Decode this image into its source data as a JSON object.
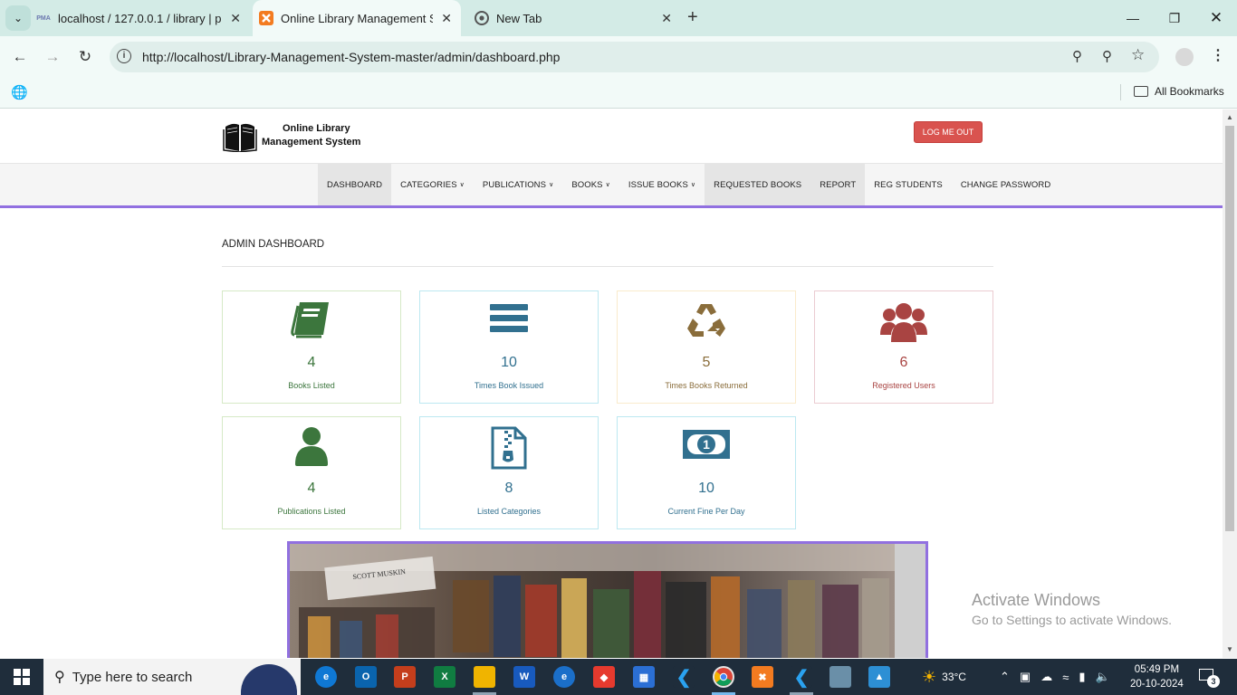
{
  "browser": {
    "tabs": [
      {
        "title": "localhost / 127.0.0.1 / library | p",
        "icon": "phpmyadmin-icon",
        "favicon_text": "PMA"
      },
      {
        "title": "Online Library Management Sys",
        "icon": "xampp-icon",
        "active": true
      },
      {
        "title": "New Tab",
        "icon": "chrome-icon"
      }
    ],
    "url": "http://localhost/Library-Management-System-master/admin/dashboard.php",
    "bookmarks_label": "All Bookmarks"
  },
  "site": {
    "brand_line1": "Online Library",
    "brand_line2": "Management System",
    "logout_label": "LOG ME OUT",
    "menu": [
      {
        "label": "DASHBOARD",
        "active": true
      },
      {
        "label": "CATEGORIES",
        "dropdown": true
      },
      {
        "label": "PUBLICATIONS",
        "dropdown": true
      },
      {
        "label": "BOOKS",
        "dropdown": true
      },
      {
        "label": "ISSUE BOOKS",
        "dropdown": true
      },
      {
        "label": "REQUESTED BOOKS",
        "active": true
      },
      {
        "label": "REPORT",
        "active": true
      },
      {
        "label": "REG STUDENTS"
      },
      {
        "label": "CHANGE PASSWORD"
      }
    ]
  },
  "dashboard": {
    "title": "ADMIN DASHBOARD",
    "cards": [
      {
        "value": "4",
        "label": "Books Listed",
        "icon": "book-icon",
        "color": "#3c763d",
        "border": "#d6e9c6"
      },
      {
        "value": "10",
        "label": "Times Book Issued",
        "icon": "bars-icon",
        "color": "#31708f",
        "border": "#bce8f1"
      },
      {
        "value": "5",
        "label": "Times Books Returned",
        "icon": "recycle-icon",
        "color": "#8a6d3b",
        "border": "#faebcc"
      },
      {
        "value": "6",
        "label": "Registered Users",
        "icon": "users-icon",
        "color": "#a94442",
        "border": "#ebccd1"
      },
      {
        "value": "4",
        "label": "Publications Listed",
        "icon": "user-icon",
        "color": "#3c763d",
        "border": "#d6e9c6"
      },
      {
        "value": "8",
        "label": "Listed Categories",
        "icon": "file-archive-icon",
        "color": "#31708f",
        "border": "#bce8f1"
      },
      {
        "value": "10",
        "label": "Current Fine Per Day",
        "icon": "money-icon",
        "color": "#31708f",
        "border": "#bce8f1"
      }
    ]
  },
  "banner": {
    "book_spine_text": "SCOTT MUSKIN"
  },
  "watermark": {
    "line1": "Activate Windows",
    "line2": "Go to Settings to activate Windows."
  },
  "taskbar": {
    "search_placeholder": "Type here to search",
    "weather": "33°C",
    "time": "05:49 PM",
    "date": "20-10-2024",
    "notifications": "3"
  }
}
